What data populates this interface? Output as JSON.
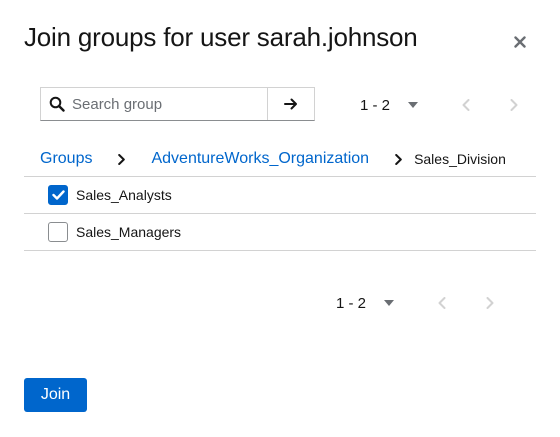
{
  "modal": {
    "title": "Join groups for user sarah.johnson",
    "close_icon": "close-icon"
  },
  "search": {
    "placeholder": "Search group",
    "value": "",
    "search_icon": "search-icon",
    "submit_icon": "arrow-right-icon"
  },
  "pagination_top": {
    "range": "1 - 2",
    "prev_icon": "chevron-left-icon",
    "next_icon": "chevron-right-icon"
  },
  "breadcrumb": {
    "items": [
      {
        "label": "Groups",
        "link": true
      },
      {
        "label": "AdventureWorks_Organization",
        "link": true
      },
      {
        "label": "Sales_Division",
        "link": false
      }
    ]
  },
  "groups": [
    {
      "name": "Sales_Analysts",
      "checked": true
    },
    {
      "name": "Sales_Managers",
      "checked": false
    }
  ],
  "pagination_bottom": {
    "range": "1 - 2",
    "prev_icon": "chevron-left-icon",
    "next_icon": "chevron-right-icon"
  },
  "actions": {
    "join_label": "Join"
  },
  "colors": {
    "primary": "#0066cc",
    "text": "#151515",
    "muted": "#6a6e73",
    "disabled": "#d2d2d2",
    "border": "#d2d2d2"
  }
}
